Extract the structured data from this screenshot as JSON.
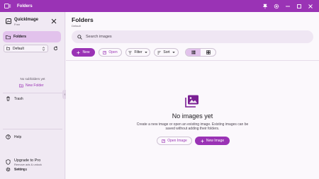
{
  "window": {
    "title": "Folders",
    "colors": {
      "accent": "#9a33b5",
      "accent_soft": "#e2c2ec",
      "surface": "#fbf8fc",
      "sidebar": "#f0e9f3"
    }
  },
  "sidebar": {
    "app_name": "QuickImage",
    "plan": "Free",
    "nav_folders": "Folders",
    "collection": {
      "selected": "Default"
    },
    "empty_text": "No subfolders yet",
    "new_folder": "New Folder",
    "trash": "Trash",
    "help": "Help",
    "upgrade": {
      "title": "Upgrade to Pro",
      "subtitle_line1": "Remove ads & unlock",
      "subtitle_line2": "features"
    },
    "settings": "Settings"
  },
  "main": {
    "title": "Folders",
    "breadcrumb": "Default",
    "search": {
      "placeholder": "Search images",
      "value": ""
    },
    "toolbar": {
      "new": "New",
      "open": "Open",
      "filter": "Filter",
      "sort": "Sort"
    },
    "empty_state": {
      "title": "No images yet",
      "line1": "Create a new image or open an existing image. Existing images can be",
      "line2": "saved without adding their folders.",
      "open_button": "Open Image",
      "new_button": "New Image"
    }
  },
  "icons": [
    "app-icon",
    "pin-icon",
    "settings-icon",
    "minimize-icon",
    "maximize-icon",
    "close-icon",
    "folder-icon",
    "chevron-down-icon",
    "refresh-icon",
    "new-folder-icon",
    "trash-icon",
    "help-icon",
    "upgrade-icon",
    "gear-icon",
    "search-icon",
    "plus-icon",
    "open-icon",
    "filter-icon",
    "sort-icon",
    "list-view-icon",
    "grid-view-icon",
    "images-icon"
  ]
}
